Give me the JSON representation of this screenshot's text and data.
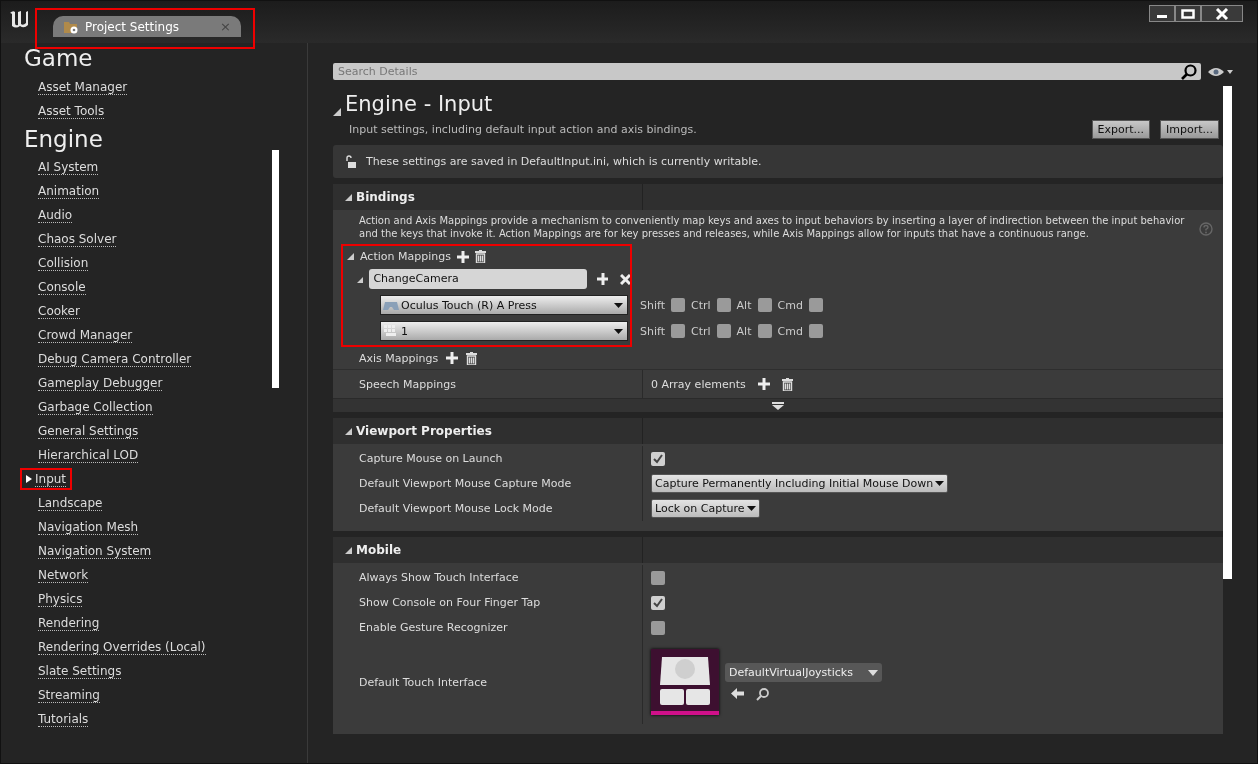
{
  "window": {
    "tab": {
      "title": "Project Settings",
      "close": "×"
    }
  },
  "sidebar": {
    "sections": [
      {
        "heading": "Game",
        "items": [
          {
            "label": "Asset Manager",
            "selected": false
          },
          {
            "label": "Asset Tools",
            "selected": false
          }
        ]
      },
      {
        "heading": "Engine",
        "items": [
          {
            "label": "AI System",
            "selected": false
          },
          {
            "label": "Animation",
            "selected": false
          },
          {
            "label": "Audio",
            "selected": false
          },
          {
            "label": "Chaos Solver",
            "selected": false
          },
          {
            "label": "Collision",
            "selected": false
          },
          {
            "label": "Console",
            "selected": false
          },
          {
            "label": "Cooker",
            "selected": false
          },
          {
            "label": "Crowd Manager",
            "selected": false
          },
          {
            "label": "Debug Camera Controller",
            "selected": false
          },
          {
            "label": "Gameplay Debugger",
            "selected": false
          },
          {
            "label": "Garbage Collection",
            "selected": false
          },
          {
            "label": "General Settings",
            "selected": false
          },
          {
            "label": "Hierarchical LOD",
            "selected": false
          },
          {
            "label": "Input",
            "selected": true
          },
          {
            "label": "Landscape",
            "selected": false
          },
          {
            "label": "Navigation Mesh",
            "selected": false
          },
          {
            "label": "Navigation System",
            "selected": false
          },
          {
            "label": "Network",
            "selected": false
          },
          {
            "label": "Physics",
            "selected": false
          },
          {
            "label": "Rendering",
            "selected": false
          },
          {
            "label": "Rendering Overrides (Local)",
            "selected": false
          },
          {
            "label": "Slate Settings",
            "selected": false
          },
          {
            "label": "Streaming",
            "selected": false
          },
          {
            "label": "Tutorials",
            "selected": false
          }
        ]
      }
    ]
  },
  "details": {
    "search": {
      "placeholder": "Search Details"
    },
    "title": "Engine - Input",
    "description": "Input settings, including default input action and axis bindings.",
    "buttons": [
      "Export...",
      "Import..."
    ],
    "notice": "These settings are saved in DefaultInput.ini, which is currently writable.",
    "bindings": {
      "title": "Bindings",
      "description": "Action and Axis Mappings provide a mechanism to conveniently map keys and axes to input behaviors by inserting a layer of indirection between the input behavior and the keys that invoke it. Action Mappings are for key presses and releases, while Axis Mappings allow for inputs that have a continuous range.",
      "action_mappings": {
        "label": "Action Mappings",
        "mappings": [
          {
            "name": "ChangeCamera",
            "keys": [
              {
                "kind": "gamepad",
                "key": "Oculus Touch (R) A Press",
                "modifiers": [
                  {
                    "label": "Shift",
                    "checked": false
                  },
                  {
                    "label": "Ctrl",
                    "checked": false
                  },
                  {
                    "label": "Alt",
                    "checked": false
                  },
                  {
                    "label": "Cmd",
                    "checked": false
                  }
                ]
              },
              {
                "kind": "keyboard",
                "key": "1",
                "modifiers": [
                  {
                    "label": "Shift",
                    "checked": false
                  },
                  {
                    "label": "Ctrl",
                    "checked": false
                  },
                  {
                    "label": "Alt",
                    "checked": false
                  },
                  {
                    "label": "Cmd",
                    "checked": false
                  }
                ]
              }
            ]
          }
        ]
      },
      "axis_mappings": {
        "label": "Axis Mappings"
      },
      "speech_mappings": {
        "label": "Speech Mappings",
        "value": "0 Array elements"
      }
    },
    "categories": [
      {
        "title": "Viewport Properties",
        "rows": [
          {
            "kind": "checkbox",
            "label": "Capture Mouse on Launch",
            "checked": true
          },
          {
            "kind": "dropdown",
            "label": "Default Viewport Mouse Capture Mode",
            "value": "Capture Permanently Including Initial Mouse Down"
          },
          {
            "kind": "dropdown",
            "label": "Default Viewport Mouse Lock Mode",
            "value": "Lock on Capture"
          }
        ]
      },
      {
        "title": "Mobile",
        "rows": [
          {
            "kind": "checkbox",
            "label": "Always Show Touch Interface",
            "checked": false
          },
          {
            "kind": "checkbox",
            "label": "Show Console on Four Finger Tap",
            "checked": true
          },
          {
            "kind": "checkbox",
            "label": "Enable Gesture Recognizer",
            "checked": false
          },
          {
            "kind": "asset",
            "label": "Default Touch Interface",
            "value": "DefaultVirtualJoysticks"
          }
        ]
      }
    ]
  }
}
